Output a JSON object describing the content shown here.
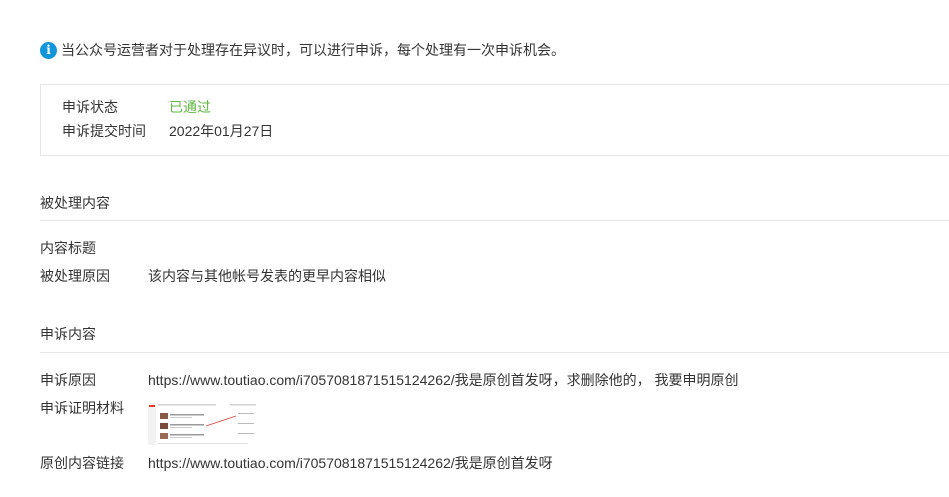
{
  "notice": {
    "icon": "info-icon",
    "text": "当公众号运营者对于处理存在异议时，可以进行申诉，每个处理有一次申诉机会。"
  },
  "status_box": {
    "status_label": "申诉状态",
    "status_value": "已通过",
    "status_color": "#5fb843",
    "time_label": "申诉提交时间",
    "time_value": "2022年01月27日"
  },
  "processed_section": {
    "title": "被处理内容",
    "title_label": "内容标题",
    "title_value": "",
    "reason_label": "被处理原因",
    "reason_value": "该内容与其他帐号发表的更早内容相似"
  },
  "appeal_section": {
    "title": "申诉内容",
    "reason_label": "申诉原因",
    "reason_value": "https://www.toutiao.com/i7057081871515124262/我是原创首发呀，求删除他的，   我要申明原创",
    "evidence_label": "申诉证明材料",
    "original_link_label": "原创内容链接",
    "original_link_value": "https://www.toutiao.com/i7057081871515124262/我是原创首发呀"
  }
}
